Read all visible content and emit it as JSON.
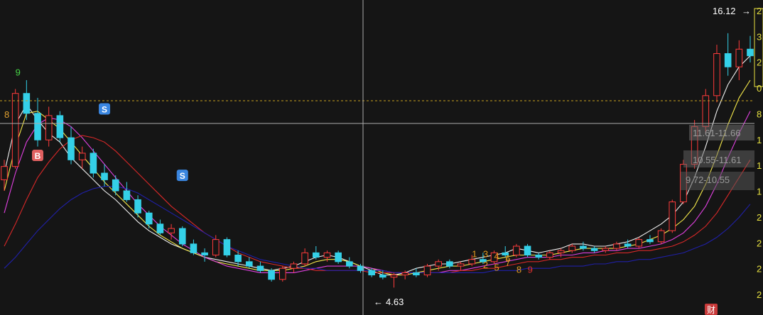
{
  "chart_data": {
    "type": "candlestick",
    "title": "",
    "ylim": [
      4.0,
      17.3
    ],
    "grid": false,
    "price_labels": {
      "high": "16.12",
      "low": "4.63"
    },
    "crosshair_price_label": "11.61-11.66",
    "volume_profile": [
      {
        "label": "11.61-11.66"
      },
      {
        "label": "10.55-11.61"
      },
      {
        "label": "9.72-10.55"
      }
    ],
    "signals": [
      {
        "label": "B",
        "type": "buy",
        "index": 3,
        "price": 10.6
      },
      {
        "label": "S",
        "type": "sell",
        "index": 9,
        "price": 12.7
      },
      {
        "label": "S",
        "type": "sell",
        "index": 16,
        "price": 9.7
      }
    ],
    "sequence_labels": [
      {
        "label": "9",
        "color": "#46d746",
        "index": 1,
        "price": 14.2
      },
      {
        "label": "8",
        "color": "#e0a030",
        "index": 0,
        "price": 12.3
      },
      {
        "label": "1",
        "color": "#e39b1e",
        "index": 42,
        "price": 6.0
      },
      {
        "label": "2",
        "color": "#e39b1e",
        "index": 43,
        "price": 5.5
      },
      {
        "label": "3",
        "color": "#e39b1e",
        "index": 43,
        "price": 6.0
      },
      {
        "label": "4",
        "color": "#e39b1e",
        "index": 44,
        "price": 5.9
      },
      {
        "label": "5",
        "color": "#e39b1e",
        "index": 44,
        "price": 5.4
      },
      {
        "label": "6",
        "color": "#e39b1e",
        "index": 45,
        "price": 5.8
      },
      {
        "label": "7",
        "color": "#e39b1e",
        "index": 45,
        "price": 5.6
      },
      {
        "label": "8",
        "color": "#e39b1e",
        "index": 46,
        "price": 5.3
      },
      {
        "label": "9",
        "color": "#e0302f",
        "index": 47,
        "price": 5.3
      }
    ],
    "right_axis_ticks": [
      "2",
      "3",
      "2",
      "0",
      "8",
      "1",
      "1",
      "1",
      "2",
      "2",
      "2",
      "2"
    ],
    "badge": "财",
    "series": [
      {
        "name": "",
        "color": "#f0f0f0",
        "values": [
          9.8,
          12.0,
          12.9,
          12.2,
          11.6,
          11.2,
          10.5,
          10.0,
          9.5,
          9.0,
          8.6,
          8.1,
          7.6,
          7.2,
          6.9,
          6.6,
          6.4,
          6.2,
          6.0,
          5.9,
          5.8,
          5.7,
          5.6,
          5.5,
          5.4,
          5.5,
          5.6,
          5.8,
          6.0,
          6.1,
          6.0,
          5.8,
          5.6,
          5.4,
          5.2,
          5.2,
          5.3,
          5.5,
          5.6,
          5.7,
          5.7,
          5.8,
          5.9,
          6.0,
          6.1,
          6.2,
          6.4,
          6.3,
          6.2,
          6.3,
          6.4,
          6.6,
          6.6,
          6.5,
          6.5,
          6.6,
          6.7,
          6.9,
          7.2,
          7.5,
          7.9,
          8.5,
          9.6,
          11.0,
          12.6,
          13.8,
          14.6,
          15.1
        ]
      },
      {
        "name": "",
        "color": "#f5e94a",
        "values": [
          9.0,
          11.0,
          12.5,
          12.6,
          12.2,
          11.8,
          11.2,
          10.6,
          10.0,
          9.4,
          8.9,
          8.4,
          7.9,
          7.4,
          7.0,
          6.7,
          6.4,
          6.2,
          6.0,
          5.8,
          5.7,
          5.6,
          5.5,
          5.4,
          5.4,
          5.4,
          5.5,
          5.6,
          5.8,
          5.9,
          5.9,
          5.8,
          5.6,
          5.5,
          5.3,
          5.2,
          5.2,
          5.3,
          5.4,
          5.5,
          5.6,
          5.6,
          5.7,
          5.8,
          5.9,
          6.0,
          6.1,
          6.1,
          6.1,
          6.1,
          6.2,
          6.3,
          6.4,
          6.4,
          6.4,
          6.4,
          6.5,
          6.6,
          6.8,
          7.0,
          7.3,
          7.7,
          8.3,
          9.3,
          10.6,
          12.0,
          13.2,
          14.0
        ]
      },
      {
        "name": "",
        "color": "#e040e0",
        "values": [
          8.0,
          9.8,
          11.2,
          12.0,
          12.3,
          12.2,
          11.9,
          11.4,
          10.8,
          10.2,
          9.6,
          9.0,
          8.4,
          7.9,
          7.4,
          7.0,
          6.6,
          6.3,
          6.0,
          5.8,
          5.6,
          5.5,
          5.4,
          5.3,
          5.3,
          5.3,
          5.3,
          5.4,
          5.5,
          5.6,
          5.6,
          5.6,
          5.6,
          5.5,
          5.4,
          5.3,
          5.3,
          5.3,
          5.3,
          5.3,
          5.4,
          5.4,
          5.5,
          5.6,
          5.7,
          5.8,
          5.9,
          6.0,
          6.0,
          6.0,
          6.1,
          6.1,
          6.2,
          6.2,
          6.3,
          6.3,
          6.4,
          6.4,
          6.5,
          6.6,
          6.8,
          7.1,
          7.6,
          8.3,
          9.3,
          10.5,
          11.6,
          12.6
        ]
      },
      {
        "name": "",
        "color": "#d82828",
        "values": [
          6.5,
          7.5,
          8.6,
          9.6,
          10.3,
          10.9,
          11.3,
          11.5,
          11.4,
          11.2,
          10.8,
          10.3,
          9.8,
          9.3,
          8.8,
          8.3,
          7.9,
          7.5,
          7.1,
          6.8,
          6.5,
          6.2,
          6.0,
          5.8,
          5.7,
          5.6,
          5.5,
          5.5,
          5.4,
          5.4,
          5.4,
          5.4,
          5.4,
          5.3,
          5.3,
          5.3,
          5.3,
          5.3,
          5.3,
          5.3,
          5.3,
          5.4,
          5.4,
          5.5,
          5.5,
          5.6,
          5.7,
          5.8,
          5.8,
          5.9,
          5.9,
          6.0,
          6.0,
          6.1,
          6.1,
          6.2,
          6.2,
          6.3,
          6.3,
          6.4,
          6.5,
          6.7,
          7.0,
          7.4,
          8.0,
          8.8,
          9.6,
          10.4
        ]
      },
      {
        "name": "",
        "color": "#2020a8",
        "values": [
          5.5,
          6.0,
          6.6,
          7.2,
          7.7,
          8.2,
          8.6,
          8.9,
          9.1,
          9.2,
          9.2,
          9.1,
          8.9,
          8.6,
          8.3,
          8.0,
          7.7,
          7.4,
          7.1,
          6.8,
          6.5,
          6.3,
          6.1,
          5.9,
          5.8,
          5.7,
          5.6,
          5.5,
          5.5,
          5.4,
          5.4,
          5.4,
          5.4,
          5.4,
          5.4,
          5.3,
          5.3,
          5.3,
          5.3,
          5.3,
          5.3,
          5.3,
          5.3,
          5.3,
          5.4,
          5.4,
          5.4,
          5.5,
          5.5,
          5.5,
          5.6,
          5.6,
          5.6,
          5.7,
          5.7,
          5.8,
          5.8,
          5.9,
          5.9,
          6.0,
          6.1,
          6.2,
          6.4,
          6.6,
          6.9,
          7.3,
          7.8,
          8.4
        ]
      }
    ],
    "ohlc": [
      [
        9.5,
        10.4,
        9.0,
        10.1
      ],
      [
        10.1,
        13.6,
        10.0,
        13.4
      ],
      [
        13.4,
        14.0,
        12.2,
        12.5
      ],
      [
        12.5,
        13.2,
        11.0,
        11.3
      ],
      [
        11.3,
        12.8,
        11.0,
        12.4
      ],
      [
        12.4,
        12.6,
        11.2,
        11.4
      ],
      [
        11.4,
        11.9,
        10.2,
        10.4
      ],
      [
        10.4,
        11.0,
        10.0,
        10.7
      ],
      [
        10.7,
        10.9,
        9.6,
        9.8
      ],
      [
        9.8,
        10.2,
        9.2,
        9.5
      ],
      [
        9.5,
        9.7,
        8.8,
        9.0
      ],
      [
        9.0,
        9.4,
        8.5,
        8.6
      ],
      [
        8.6,
        8.8,
        7.8,
        8.0
      ],
      [
        8.0,
        8.1,
        7.3,
        7.5
      ],
      [
        7.5,
        7.7,
        7.0,
        7.1
      ],
      [
        7.1,
        7.5,
        6.8,
        7.3
      ],
      [
        7.3,
        7.4,
        6.5,
        6.6
      ],
      [
        6.6,
        6.8,
        6.1,
        6.2
      ],
      [
        6.2,
        6.4,
        5.8,
        6.1
      ],
      [
        6.1,
        7.0,
        6.0,
        6.8
      ],
      [
        6.8,
        6.9,
        6.0,
        6.1
      ],
      [
        6.1,
        6.3,
        5.6,
        5.8
      ],
      [
        5.8,
        6.0,
        5.5,
        5.6
      ],
      [
        5.6,
        5.8,
        5.3,
        5.4
      ],
      [
        5.4,
        5.5,
        4.9,
        5.0
      ],
      [
        5.0,
        5.6,
        4.9,
        5.5
      ],
      [
        5.5,
        5.8,
        5.3,
        5.7
      ],
      [
        5.7,
        6.4,
        5.6,
        6.2
      ],
      [
        6.2,
        6.5,
        5.9,
        6.0
      ],
      [
        6.0,
        6.3,
        5.8,
        6.2
      ],
      [
        6.2,
        6.3,
        5.7,
        5.8
      ],
      [
        5.8,
        6.0,
        5.5,
        5.6
      ],
      [
        5.6,
        5.7,
        5.3,
        5.4
      ],
      [
        5.4,
        5.5,
        5.1,
        5.2
      ],
      [
        5.2,
        5.4,
        5.0,
        5.1
      ],
      [
        5.1,
        5.3,
        4.63,
        5.2
      ],
      [
        5.2,
        5.4,
        5.0,
        5.3
      ],
      [
        5.3,
        5.5,
        5.1,
        5.2
      ],
      [
        5.2,
        5.7,
        5.1,
        5.6
      ],
      [
        5.6,
        5.9,
        5.4,
        5.8
      ],
      [
        5.8,
        5.9,
        5.5,
        5.6
      ],
      [
        5.6,
        5.8,
        5.4,
        5.7
      ],
      [
        5.7,
        6.1,
        5.6,
        5.9
      ],
      [
        5.9,
        6.2,
        5.7,
        5.8
      ],
      [
        5.8,
        6.3,
        5.7,
        6.2
      ],
      [
        6.2,
        6.5,
        6.0,
        6.1
      ],
      [
        6.1,
        6.6,
        6.0,
        6.5
      ],
      [
        6.5,
        6.6,
        6.0,
        6.1
      ],
      [
        6.1,
        6.2,
        5.9,
        6.0
      ],
      [
        6.0,
        6.3,
        5.9,
        6.2
      ],
      [
        6.2,
        6.4,
        6.0,
        6.3
      ],
      [
        6.3,
        6.6,
        6.2,
        6.5
      ],
      [
        6.5,
        6.7,
        6.3,
        6.4
      ],
      [
        6.4,
        6.5,
        6.2,
        6.3
      ],
      [
        6.3,
        6.5,
        6.2,
        6.4
      ],
      [
        6.4,
        6.7,
        6.3,
        6.6
      ],
      [
        6.6,
        6.8,
        6.4,
        6.5
      ],
      [
        6.5,
        6.9,
        6.4,
        6.8
      ],
      [
        6.8,
        7.0,
        6.6,
        6.7
      ],
      [
        6.7,
        7.3,
        6.6,
        7.2
      ],
      [
        7.2,
        8.6,
        7.1,
        8.5
      ],
      [
        8.5,
        10.4,
        8.4,
        10.2
      ],
      [
        10.2,
        12.2,
        10.0,
        11.9
      ],
      [
        11.9,
        13.6,
        11.6,
        13.3
      ],
      [
        13.3,
        15.6,
        13.0,
        15.2
      ],
      [
        15.2,
        16.12,
        14.2,
        14.6
      ],
      [
        14.6,
        15.8,
        14.0,
        15.4
      ],
      [
        15.4,
        16.0,
        14.8,
        15.1
      ]
    ]
  }
}
